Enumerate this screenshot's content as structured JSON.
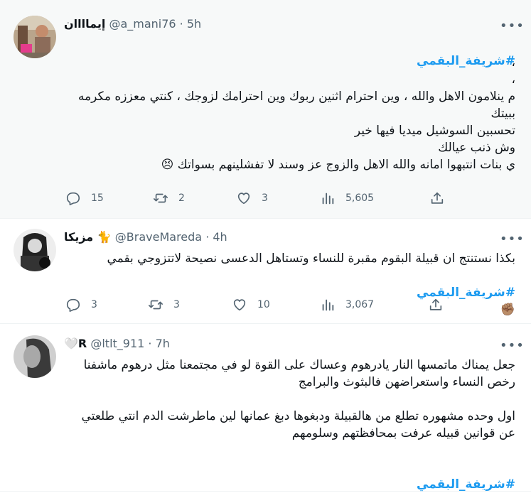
{
  "tweets": [
    {
      "name": "إيماااان",
      "handle": "@a_mani76",
      "dot": "·",
      "time": "5h",
      "hashtag": "#شريفة_البقمي",
      "text": "،\n،\nم ينلامون الاهل والله ، وين احترام اثنين ربوك وين احترامك لزوجك ، كنتي معززه مكرمه ببيتك\nتحسبين السوشيل ميديا فيها خير\nوش ذنب عيالك\nي بنات انتبهوا امانه والله الاهل والزوج عز وسند لا تفشلينهم بسواتك 😣",
      "replies": "15",
      "retweets": "2",
      "likes": "3",
      "views": "5,605"
    },
    {
      "name": "مزيكا 🐈",
      "handle": "@BraveMareda",
      "dot": "·",
      "time": "4h",
      "text": "بكذا نستنتج ان قبيلة البقوم مقبرة للنساء وتستاهل الدعسى نصيحة لاتتزوجي بقمي",
      "hashtag": "#شريفة_البقمي",
      "emoji": "✊🏽",
      "replies": "3",
      "retweets": "3",
      "likes": "10",
      "views": "3,067"
    },
    {
      "name": "🤍R",
      "handle": "@ltlt_911",
      "dot": "·",
      "time": "7h",
      "text": "جعل يمناك ماتمسها النار يادرهوم وعساك على القوة لو في مجتمعنا مثل درهوم ماشفنا رخص النساء واستعراضهن فالبثوث والبرامج\n\nاول وحده مشهوره تطلع من هالقبيلة ودبغوها دبغ عمانها لين ماطرشت الدم انتي طلعتي عن قوانين قبيله عرفت بمحافظتهم وسلومهم",
      "hashtag": "#شريفة_البقمي"
    }
  ],
  "icons": {
    "reply": "reply-icon",
    "retweet": "retweet-icon",
    "like": "heart-icon",
    "views": "views-icon",
    "share": "share-icon",
    "more": "more-icon"
  },
  "colors": {
    "hashtag": "#1d9bf0",
    "secondary": "#536471",
    "highlight_bg": "#f7f9f9"
  }
}
